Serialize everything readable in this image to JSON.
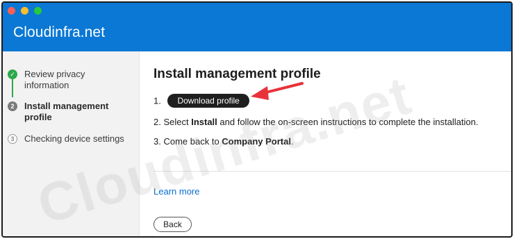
{
  "window": {
    "title": "Cloudinfra.net"
  },
  "sidebar": {
    "steps": [
      {
        "number": "✓",
        "label": "Review privacy information",
        "state": "done"
      },
      {
        "number": "2",
        "label": "Install management profile",
        "state": "current"
      },
      {
        "number": "3",
        "label": "Checking device settings",
        "state": "pending"
      }
    ]
  },
  "main": {
    "title": "Install management profile",
    "steps": [
      {
        "index": "1.",
        "button_label": "Download profile"
      },
      {
        "index": "2.",
        "prefix": "Select ",
        "bold": "Install",
        "suffix": " and follow the on-screen instructions to complete the installation."
      },
      {
        "index": "3.",
        "prefix": "Come back to ",
        "bold": "Company Portal",
        "suffix": "."
      }
    ],
    "learn_more": "Learn more",
    "back_label": "Back"
  },
  "watermark": "Cloudinfra.net",
  "colors": {
    "header": "#0a78d4",
    "done": "#2da84a",
    "arrow": "#e8323a",
    "link": "#0a6ed1"
  }
}
